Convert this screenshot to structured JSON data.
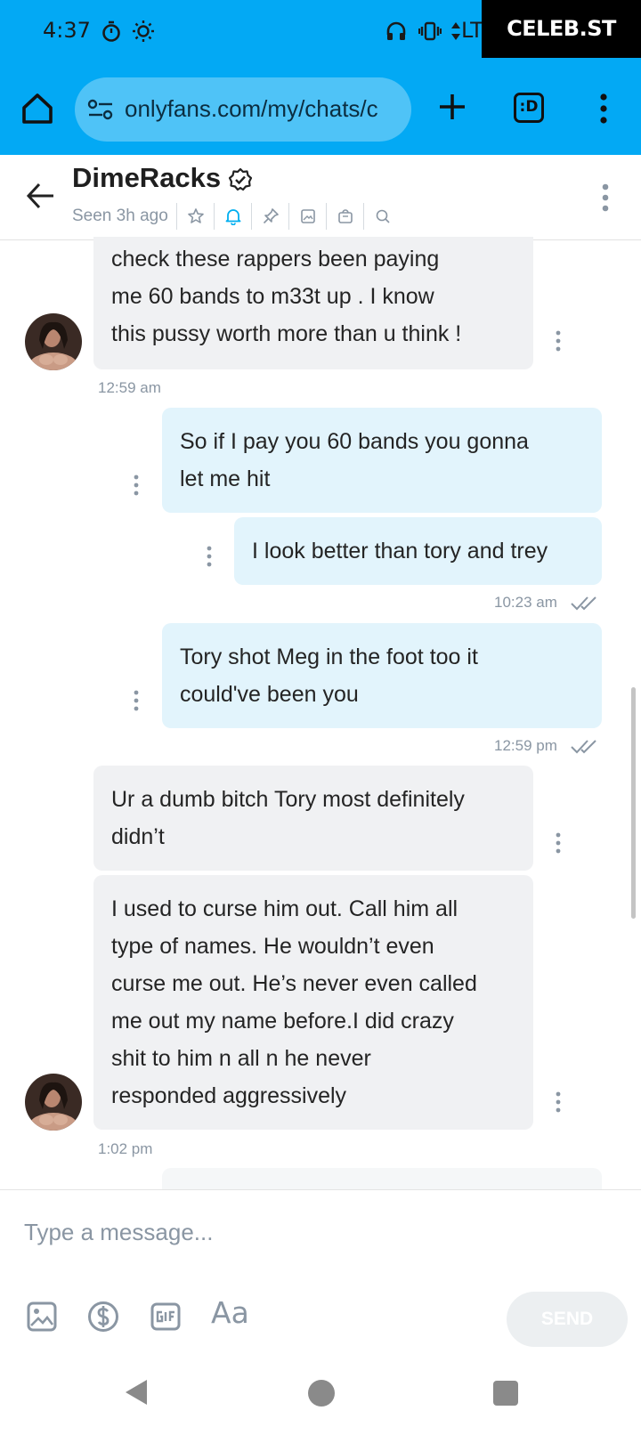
{
  "status_bar": {
    "time": "4:37",
    "icons": [
      "timer-icon",
      "brightness-icon",
      "headphones-icon",
      "vibrate-icon",
      "data-arrows-icon"
    ],
    "network_label": "LT"
  },
  "watermark": {
    "text": "CELEB.ST"
  },
  "browser": {
    "url": "onlyfans.com/my/chats/c",
    "tabs_label": ":D"
  },
  "chat": {
    "name": "DimeRacks",
    "seen": "Seen 3h ago",
    "header_icons": [
      "star-icon",
      "bell-icon",
      "pin-icon",
      "image-icon",
      "bag-icon",
      "search-icon"
    ],
    "accent": "#00aff0"
  },
  "messages": [
    {
      "dir": "in",
      "lines": [
        "check these rappers been paying",
        "me 60 bands to m33t up . I know",
        "this pussy worth more than u think !"
      ]
    },
    {
      "dir": "out",
      "lines": [
        "So if I pay you 60 bands you gonna",
        "let me hit"
      ]
    },
    {
      "dir": "out",
      "lines": [
        "I look better than tory and trey"
      ]
    },
    {
      "dir": "out",
      "lines": [
        "Tory shot Meg in the foot too it",
        "could've been you"
      ]
    },
    {
      "dir": "in",
      "lines": [
        "Ur a dumb bitch Tory most definitely",
        "didn’t"
      ]
    },
    {
      "dir": "in",
      "lines": [
        "I used to curse him out. Call him all",
        "type of names. He wouldn’t even",
        "curse me out. He’s never even called",
        "me out my name before.I did crazy",
        "shit to him n all n he never",
        "responded aggressively"
      ]
    }
  ],
  "timestamps": [
    "12:59 am",
    "10:23 am",
    "12:59 pm",
    "1:02 pm"
  ],
  "composer": {
    "placeholder": "Type a message...",
    "tools": [
      "image-icon",
      "dollar-icon",
      "gif-icon"
    ],
    "text_tool": "Aa",
    "send": "SEND"
  },
  "nav": [
    "back-icon",
    "home-icon",
    "recents-icon"
  ],
  "colors": {
    "browser_bar": "#03a9f4",
    "incoming_bubble": "#f0f1f3",
    "outgoing_bubble": "#e2f4fc",
    "muted_text": "#8a96a3"
  }
}
